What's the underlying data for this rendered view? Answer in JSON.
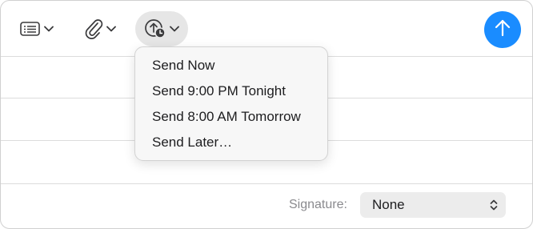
{
  "toolbar": {
    "format_button_icon": "list-format-icon",
    "attach_button_icon": "paperclip-icon",
    "send_later_button_icon": "clock-arrow-up-icon",
    "send_button_icon": "arrow-up-icon"
  },
  "send_menu": {
    "items": [
      {
        "label": "Send Now"
      },
      {
        "label": "Send 9:00 PM Tonight"
      },
      {
        "label": "Send 8:00 AM Tomorrow"
      },
      {
        "label": "Send Later…"
      }
    ]
  },
  "signature": {
    "label": "Signature:",
    "selected": "None"
  },
  "colors": {
    "accent": "#1a8cff",
    "menu_bg": "#f7f7f7",
    "selected_button_bg": "#e6e6e6"
  }
}
